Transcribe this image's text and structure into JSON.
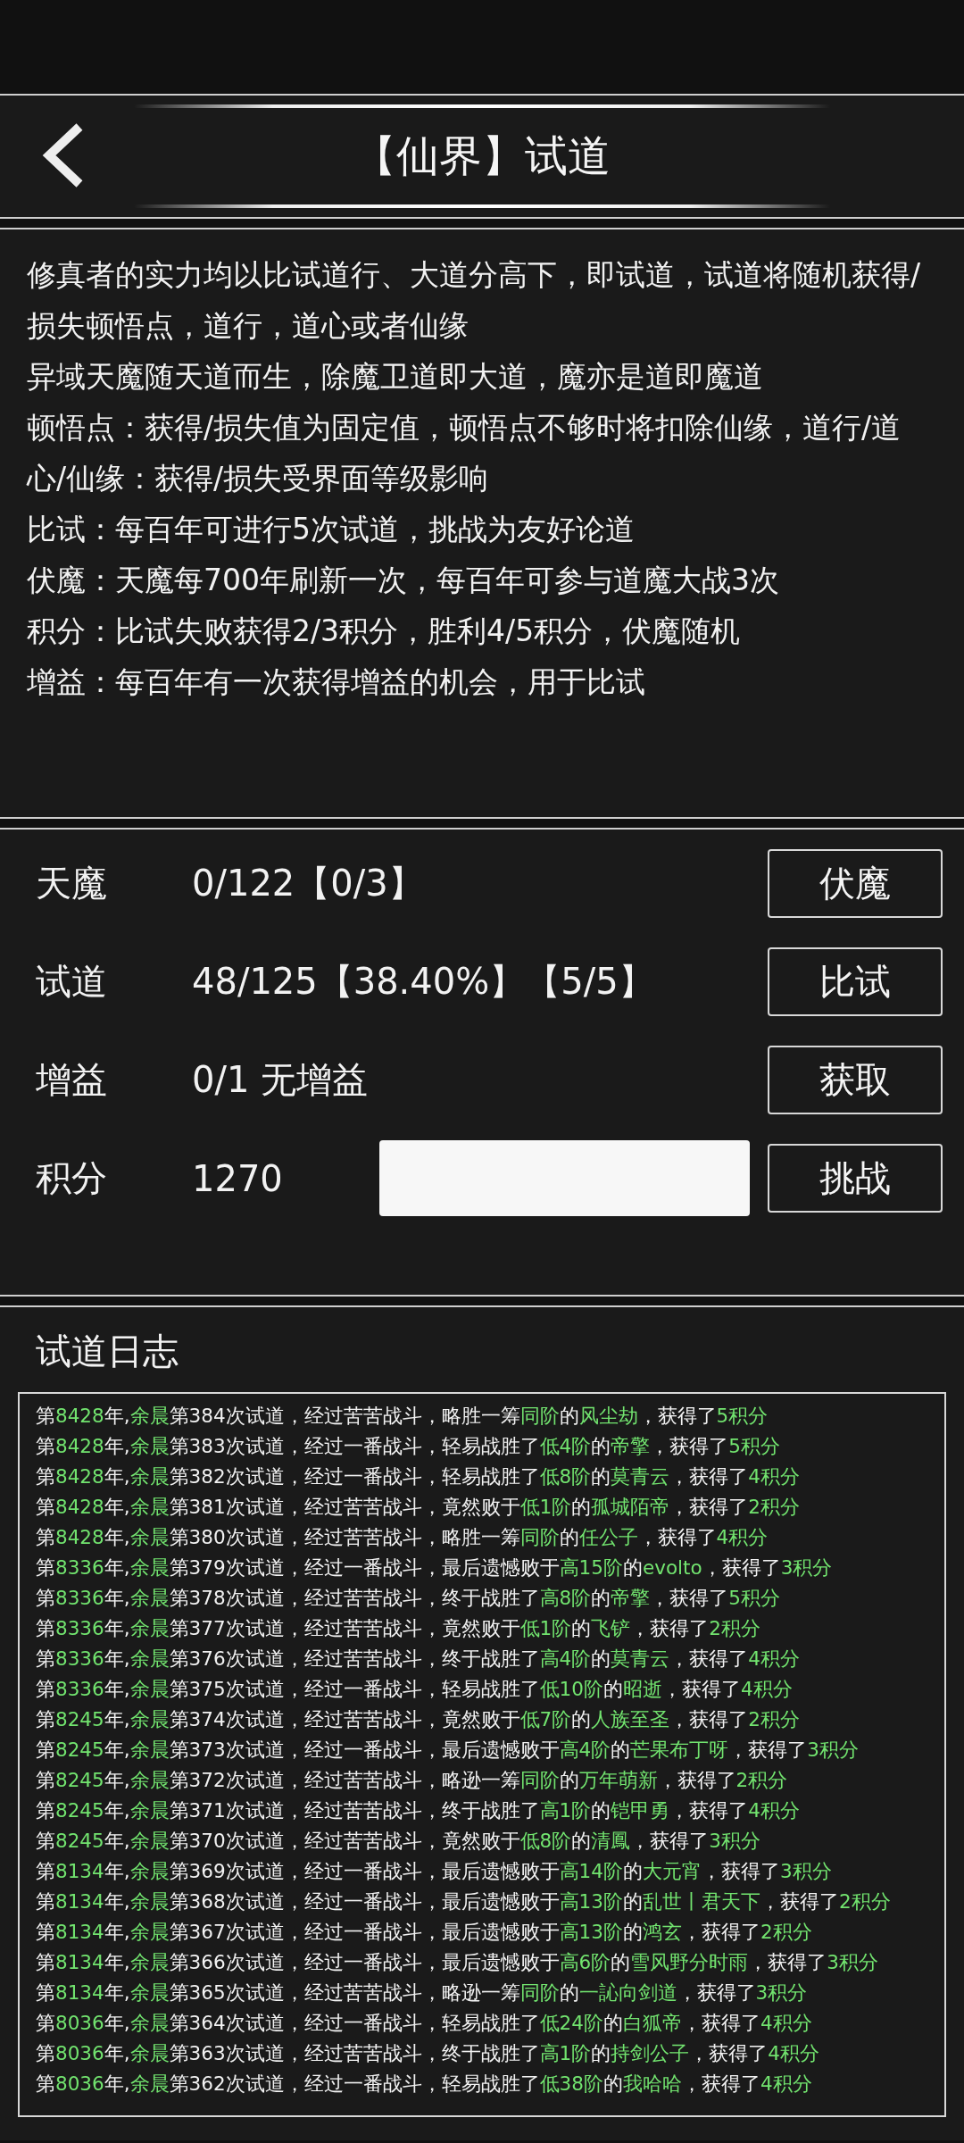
{
  "header": {
    "title": "【仙界】试道"
  },
  "description": [
    "修真者的实力均以比试道行、大道分高下，即试道，试道将随机获得/损失顿悟点，道行，道心或者仙缘",
    "异域天魔随天道而生，除魔卫道即大道，魔亦是道即魔道",
    "顿悟点：获得/损失值为固定值，顿悟点不够时将扣除仙缘，道行/道心/仙缘：获得/损失受界面等级影响",
    "比试：每百年可进行5次试道，挑战为友好论道",
    "伏魔：天魔每700年刷新一次，每百年可参与道魔大战3次",
    "积分：比试失败获得2/3积分，胜利4/5积分，伏魔随机",
    "增益：每百年有一次获得增益的机会，用于比试"
  ],
  "stats": [
    {
      "label": "天魔",
      "value": "0/122【0/3】",
      "button": "伏魔"
    },
    {
      "label": "试道",
      "value": "48/125【38.40%】【5/5】",
      "button": "比试"
    },
    {
      "label": "增益",
      "value": "0/1 无增益",
      "button": "获取"
    },
    {
      "label": "积分",
      "value": "1270",
      "kind": "input",
      "button": "挑战"
    }
  ],
  "log": {
    "title": "试道日志",
    "entries": [
      [
        {
          "t": "第",
          "hl": false
        },
        {
          "t": "8428",
          "hl": true
        },
        {
          "t": "年,",
          "hl": false
        },
        {
          "t": "余晨",
          "hl": true
        },
        {
          "t": "第384次试道，经过苦苦战斗，略胜一筹",
          "hl": false
        },
        {
          "t": "同阶",
          "hl": true
        },
        {
          "t": "的",
          "hl": false
        },
        {
          "t": "风尘劫",
          "hl": true
        },
        {
          "t": "，获得了",
          "hl": false
        },
        {
          "t": "5积分",
          "hl": true
        }
      ],
      [
        {
          "t": "第",
          "hl": false
        },
        {
          "t": "8428",
          "hl": true
        },
        {
          "t": "年,",
          "hl": false
        },
        {
          "t": "余晨",
          "hl": true
        },
        {
          "t": "第383次试道，经过一番战斗，轻易战胜了",
          "hl": false
        },
        {
          "t": "低4阶",
          "hl": true
        },
        {
          "t": "的",
          "hl": false
        },
        {
          "t": "帝擎",
          "hl": true
        },
        {
          "t": "，获得了",
          "hl": false
        },
        {
          "t": "5积分",
          "hl": true
        }
      ],
      [
        {
          "t": "第",
          "hl": false
        },
        {
          "t": "8428",
          "hl": true
        },
        {
          "t": "年,",
          "hl": false
        },
        {
          "t": "余晨",
          "hl": true
        },
        {
          "t": "第382次试道，经过一番战斗，轻易战胜了",
          "hl": false
        },
        {
          "t": "低8阶",
          "hl": true
        },
        {
          "t": "的",
          "hl": false
        },
        {
          "t": "莫青云",
          "hl": true
        },
        {
          "t": "，获得了",
          "hl": false
        },
        {
          "t": "4积分",
          "hl": true
        }
      ],
      [
        {
          "t": "第",
          "hl": false
        },
        {
          "t": "8428",
          "hl": true
        },
        {
          "t": "年,",
          "hl": false
        },
        {
          "t": "余晨",
          "hl": true
        },
        {
          "t": "第381次试道，经过苦苦战斗，竟然败于",
          "hl": false
        },
        {
          "t": "低1阶",
          "hl": true
        },
        {
          "t": "的",
          "hl": false
        },
        {
          "t": "孤城陌帝",
          "hl": true
        },
        {
          "t": "，获得了",
          "hl": false
        },
        {
          "t": "2积分",
          "hl": true
        }
      ],
      [
        {
          "t": "第",
          "hl": false
        },
        {
          "t": "8428",
          "hl": true
        },
        {
          "t": "年,",
          "hl": false
        },
        {
          "t": "余晨",
          "hl": true
        },
        {
          "t": "第380次试道，经过苦苦战斗，略胜一筹",
          "hl": false
        },
        {
          "t": "同阶",
          "hl": true
        },
        {
          "t": "的",
          "hl": false
        },
        {
          "t": "任公子",
          "hl": true
        },
        {
          "t": "，获得了",
          "hl": false
        },
        {
          "t": "4积分",
          "hl": true
        }
      ],
      [
        {
          "t": "第",
          "hl": false
        },
        {
          "t": "8336",
          "hl": true
        },
        {
          "t": "年,",
          "hl": false
        },
        {
          "t": "余晨",
          "hl": true
        },
        {
          "t": "第379次试道，经过一番战斗，最后遗憾败于",
          "hl": false
        },
        {
          "t": "高15阶",
          "hl": true
        },
        {
          "t": "的",
          "hl": false
        },
        {
          "t": "evolto",
          "hl": true
        },
        {
          "t": "，获得了",
          "hl": false
        },
        {
          "t": "3积分",
          "hl": true
        }
      ],
      [
        {
          "t": "第",
          "hl": false
        },
        {
          "t": "8336",
          "hl": true
        },
        {
          "t": "年,",
          "hl": false
        },
        {
          "t": "余晨",
          "hl": true
        },
        {
          "t": "第378次试道，经过苦苦战斗，终于战胜了",
          "hl": false
        },
        {
          "t": "高8阶",
          "hl": true
        },
        {
          "t": "的",
          "hl": false
        },
        {
          "t": "帝擎",
          "hl": true
        },
        {
          "t": "，获得了",
          "hl": false
        },
        {
          "t": "5积分",
          "hl": true
        }
      ],
      [
        {
          "t": "第",
          "hl": false
        },
        {
          "t": "8336",
          "hl": true
        },
        {
          "t": "年,",
          "hl": false
        },
        {
          "t": "余晨",
          "hl": true
        },
        {
          "t": "第377次试道，经过苦苦战斗，竟然败于",
          "hl": false
        },
        {
          "t": "低1阶",
          "hl": true
        },
        {
          "t": "的",
          "hl": false
        },
        {
          "t": "飞铲",
          "hl": true
        },
        {
          "t": "，获得了",
          "hl": false
        },
        {
          "t": "2积分",
          "hl": true
        }
      ],
      [
        {
          "t": "第",
          "hl": false
        },
        {
          "t": "8336",
          "hl": true
        },
        {
          "t": "年,",
          "hl": false
        },
        {
          "t": "余晨",
          "hl": true
        },
        {
          "t": "第376次试道，经过苦苦战斗，终于战胜了",
          "hl": false
        },
        {
          "t": "高4阶",
          "hl": true
        },
        {
          "t": "的",
          "hl": false
        },
        {
          "t": "莫青云",
          "hl": true
        },
        {
          "t": "，获得了",
          "hl": false
        },
        {
          "t": "4积分",
          "hl": true
        }
      ],
      [
        {
          "t": "第",
          "hl": false
        },
        {
          "t": "8336",
          "hl": true
        },
        {
          "t": "年,",
          "hl": false
        },
        {
          "t": "余晨",
          "hl": true
        },
        {
          "t": "第375次试道，经过一番战斗，轻易战胜了",
          "hl": false
        },
        {
          "t": "低10阶",
          "hl": true
        },
        {
          "t": "的",
          "hl": false
        },
        {
          "t": "昭逝",
          "hl": true
        },
        {
          "t": "，获得了",
          "hl": false
        },
        {
          "t": "4积分",
          "hl": true
        }
      ],
      [
        {
          "t": "第",
          "hl": false
        },
        {
          "t": "8245",
          "hl": true
        },
        {
          "t": "年,",
          "hl": false
        },
        {
          "t": "余晨",
          "hl": true
        },
        {
          "t": "第374次试道，经过苦苦战斗，竟然败于",
          "hl": false
        },
        {
          "t": "低7阶",
          "hl": true
        },
        {
          "t": "的",
          "hl": false
        },
        {
          "t": "人族至圣",
          "hl": true
        },
        {
          "t": "，获得了",
          "hl": false
        },
        {
          "t": "2积分",
          "hl": true
        }
      ],
      [
        {
          "t": "第",
          "hl": false
        },
        {
          "t": "8245",
          "hl": true
        },
        {
          "t": "年,",
          "hl": false
        },
        {
          "t": "余晨",
          "hl": true
        },
        {
          "t": "第373次试道，经过一番战斗，最后遗憾败于",
          "hl": false
        },
        {
          "t": "高4阶",
          "hl": true
        },
        {
          "t": "的",
          "hl": false
        },
        {
          "t": "芒果布丁呀",
          "hl": true
        },
        {
          "t": "，获得了",
          "hl": false
        },
        {
          "t": "3积分",
          "hl": true
        }
      ],
      [
        {
          "t": "第",
          "hl": false
        },
        {
          "t": "8245",
          "hl": true
        },
        {
          "t": "年,",
          "hl": false
        },
        {
          "t": "余晨",
          "hl": true
        },
        {
          "t": "第372次试道，经过苦苦战斗，略逊一筹",
          "hl": false
        },
        {
          "t": "同阶",
          "hl": true
        },
        {
          "t": "的",
          "hl": false
        },
        {
          "t": "万年萌新",
          "hl": true
        },
        {
          "t": "，获得了",
          "hl": false
        },
        {
          "t": "2积分",
          "hl": true
        }
      ],
      [
        {
          "t": "第",
          "hl": false
        },
        {
          "t": "8245",
          "hl": true
        },
        {
          "t": "年,",
          "hl": false
        },
        {
          "t": "余晨",
          "hl": true
        },
        {
          "t": "第371次试道，经过苦苦战斗，终于战胜了",
          "hl": false
        },
        {
          "t": "高1阶",
          "hl": true
        },
        {
          "t": "的",
          "hl": false
        },
        {
          "t": "铠甲勇",
          "hl": true
        },
        {
          "t": "，获得了",
          "hl": false
        },
        {
          "t": "4积分",
          "hl": true
        }
      ],
      [
        {
          "t": "第",
          "hl": false
        },
        {
          "t": "8245",
          "hl": true
        },
        {
          "t": "年,",
          "hl": false
        },
        {
          "t": "余晨",
          "hl": true
        },
        {
          "t": "第370次试道，经过苦苦战斗，竟然败于",
          "hl": false
        },
        {
          "t": "低8阶",
          "hl": true
        },
        {
          "t": "的",
          "hl": false
        },
        {
          "t": "清鳳",
          "hl": true
        },
        {
          "t": "，获得了",
          "hl": false
        },
        {
          "t": "3积分",
          "hl": true
        }
      ],
      [
        {
          "t": "第",
          "hl": false
        },
        {
          "t": "8134",
          "hl": true
        },
        {
          "t": "年,",
          "hl": false
        },
        {
          "t": "余晨",
          "hl": true
        },
        {
          "t": "第369次试道，经过一番战斗，最后遗憾败于",
          "hl": false
        },
        {
          "t": "高14阶",
          "hl": true
        },
        {
          "t": "的",
          "hl": false
        },
        {
          "t": "大元宵",
          "hl": true
        },
        {
          "t": "，获得了",
          "hl": false
        },
        {
          "t": "3积分",
          "hl": true
        }
      ],
      [
        {
          "t": "第",
          "hl": false
        },
        {
          "t": "8134",
          "hl": true
        },
        {
          "t": "年,",
          "hl": false
        },
        {
          "t": "余晨",
          "hl": true
        },
        {
          "t": "第368次试道，经过一番战斗，最后遗憾败于",
          "hl": false
        },
        {
          "t": "高13阶",
          "hl": true
        },
        {
          "t": "的",
          "hl": false
        },
        {
          "t": "乱世丨君天下",
          "hl": true
        },
        {
          "t": "，获得了",
          "hl": false
        },
        {
          "t": "2积分",
          "hl": true
        }
      ],
      [
        {
          "t": "第",
          "hl": false
        },
        {
          "t": "8134",
          "hl": true
        },
        {
          "t": "年,",
          "hl": false
        },
        {
          "t": "余晨",
          "hl": true
        },
        {
          "t": "第367次试道，经过一番战斗，最后遗憾败于",
          "hl": false
        },
        {
          "t": "高13阶",
          "hl": true
        },
        {
          "t": "的",
          "hl": false
        },
        {
          "t": "鸿玄",
          "hl": true
        },
        {
          "t": "，获得了",
          "hl": false
        },
        {
          "t": "2积分",
          "hl": true
        }
      ],
      [
        {
          "t": "第",
          "hl": false
        },
        {
          "t": "8134",
          "hl": true
        },
        {
          "t": "年,",
          "hl": false
        },
        {
          "t": "余晨",
          "hl": true
        },
        {
          "t": "第366次试道，经过一番战斗，最后遗憾败于",
          "hl": false
        },
        {
          "t": "高6阶",
          "hl": true
        },
        {
          "t": "的",
          "hl": false
        },
        {
          "t": "雪风野分时雨",
          "hl": true
        },
        {
          "t": "，获得了",
          "hl": false
        },
        {
          "t": "3积分",
          "hl": true
        }
      ],
      [
        {
          "t": "第",
          "hl": false
        },
        {
          "t": "8134",
          "hl": true
        },
        {
          "t": "年,",
          "hl": false
        },
        {
          "t": "余晨",
          "hl": true
        },
        {
          "t": "第365次试道，经过苦苦战斗，略逊一筹",
          "hl": false
        },
        {
          "t": "同阶",
          "hl": true
        },
        {
          "t": "的",
          "hl": false
        },
        {
          "t": "一訫向剑道",
          "hl": true
        },
        {
          "t": "，获得了",
          "hl": false
        },
        {
          "t": "3积分",
          "hl": true
        }
      ],
      [
        {
          "t": "第",
          "hl": false
        },
        {
          "t": "8036",
          "hl": true
        },
        {
          "t": "年,",
          "hl": false
        },
        {
          "t": "余晨",
          "hl": true
        },
        {
          "t": "第364次试道，经过一番战斗，轻易战胜了",
          "hl": false
        },
        {
          "t": "低24阶",
          "hl": true
        },
        {
          "t": "的",
          "hl": false
        },
        {
          "t": "白狐帝",
          "hl": true
        },
        {
          "t": "，获得了",
          "hl": false
        },
        {
          "t": "4积分",
          "hl": true
        }
      ],
      [
        {
          "t": "第",
          "hl": false
        },
        {
          "t": "8036",
          "hl": true
        },
        {
          "t": "年,",
          "hl": false
        },
        {
          "t": "余晨",
          "hl": true
        },
        {
          "t": "第363次试道，经过苦苦战斗，终于战胜了",
          "hl": false
        },
        {
          "t": "高1阶",
          "hl": true
        },
        {
          "t": "的",
          "hl": false
        },
        {
          "t": "持剑公子",
          "hl": true
        },
        {
          "t": "，获得了",
          "hl": false
        },
        {
          "t": "4积分",
          "hl": true
        }
      ],
      [
        {
          "t": "第",
          "hl": false
        },
        {
          "t": "8036",
          "hl": true
        },
        {
          "t": "年,",
          "hl": false
        },
        {
          "t": "余晨",
          "hl": true
        },
        {
          "t": "第362次试道，经过一番战斗，轻易战胜了",
          "hl": false
        },
        {
          "t": "低38阶",
          "hl": true
        },
        {
          "t": "的",
          "hl": false
        },
        {
          "t": "我哈哈",
          "hl": true
        },
        {
          "t": "，获得了",
          "hl": false
        },
        {
          "t": "4积分",
          "hl": true
        }
      ]
    ]
  }
}
